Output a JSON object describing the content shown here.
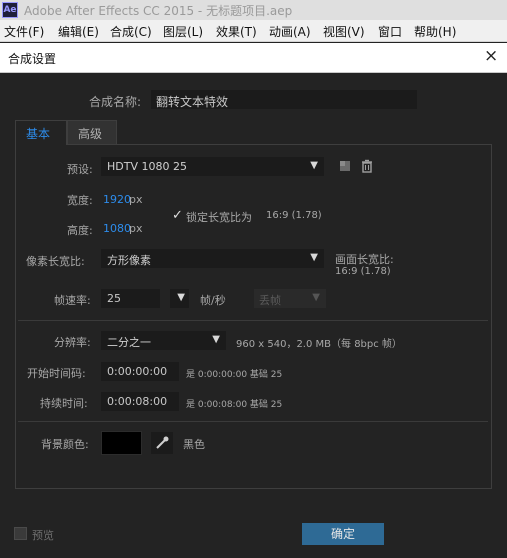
{
  "window": {
    "app_icon": "Ae",
    "title": "Adobe After Effects CC 2015 - 无标题项目.aep"
  },
  "menu": {
    "items": [
      "文件(F)",
      "编辑(E)",
      "合成(C)",
      "图层(L)",
      "效果(T)",
      "动画(A)",
      "视图(V)",
      "窗口",
      "帮助(H)"
    ]
  },
  "dialog": {
    "title": "合成设置",
    "close_icon": "×"
  },
  "comp": {
    "name_label": "合成名称:",
    "name_value": "翻转文本特效"
  },
  "tabs": {
    "basic": "基本",
    "advanced": "高级"
  },
  "basic": {
    "preset_label": "预设:",
    "preset_value": "HDTV 1080 25",
    "width_label": "宽度:",
    "width_value": "1920",
    "width_unit": "px",
    "height_label": "高度:",
    "height_value": "1080",
    "height_unit": "px",
    "lock_label": "锁定长宽比为",
    "lock_ratio": "16:9 (1.78)",
    "lock_checked": true,
    "pixel_aspect_label": "像素长宽比:",
    "pixel_aspect_value": "方形像素",
    "frame_aspect_label": "画面长宽比:",
    "frame_aspect_value": "16:9 (1.78)",
    "fps_label": "帧速率:",
    "fps_value": "25",
    "fps_unit": "帧/秒",
    "drop_frame_value": "丢帧",
    "resolution_label": "分辨率:",
    "resolution_value": "二分之一",
    "resolution_info": "960 x 540，2.0 MB（每 8bpc 帧）",
    "start_tc_label": "开始时间码:",
    "start_tc_value": "0:00:00:00",
    "start_tc_info": "是 0:00:00:00  基础 25",
    "duration_label": "持续时间:",
    "duration_value": "0:00:08:00",
    "duration_info": "是 0:00:08:00  基础 25",
    "bg_color_label": "背景颜色:",
    "bg_color_name": "黑色",
    "bg_color_hex": "#000000"
  },
  "footer": {
    "preview_label": "预览",
    "ok_label": "确定"
  },
  "icons": {
    "save_preset": "save-preset-icon",
    "delete_preset": "trash-icon",
    "eyedropper": "eyedropper-icon"
  },
  "colors": {
    "accent": "#2d8ceb",
    "dialog_bg": "#232323",
    "field_bg": "#1b1b1b",
    "ok_button": "#2e6a95"
  }
}
